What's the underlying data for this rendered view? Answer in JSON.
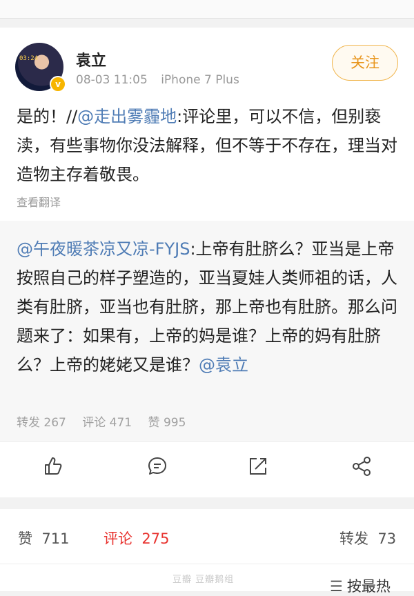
{
  "post": {
    "author": "袁立",
    "date": "08-03 11:05",
    "device": "iPhone 7 Plus",
    "follow_label": "关注",
    "avatar_text": "03:24",
    "text_prefix": "是的！//",
    "mention": "@走出雾霾地",
    "text_rest": ":评论里，可以不信，但别亵渎，有些事物你没法解释，但不等于不存在，理当对造物主存着敬畏。",
    "translate_label": "查看翻译"
  },
  "quoted": {
    "mention": "@午夜暖茶凉又凉-FYJS",
    "text": ":上帝有肚脐么？亚当是上帝按照自己的样子塑造的，亚当夏娃人类师祖的话，人类有肚脐，亚当也有肚脐，那上帝也有肚脐。那么问题来了：如果有，上帝的妈是谁？上帝的妈有肚脐么？上帝的姥姥又是谁？",
    "mention2": "@袁立",
    "stats": {
      "repost_label": "转发",
      "repost_count": "267",
      "comment_label": "评论",
      "comment_count": "471",
      "like_label": "赞",
      "like_count": "995"
    }
  },
  "actions": [
    "thumb-up-icon",
    "comment-icon",
    "share-out-icon",
    "share-nodes-icon"
  ],
  "bottom": {
    "like_label": "赞",
    "like_count": "711",
    "comment_label": "评论",
    "comment_count": "275",
    "repost_label": "转发",
    "repost_count": "73",
    "sort_label": "按最热",
    "watermark": "豆瓣 豆瓣鹅组"
  },
  "colors": {
    "link": "#4f7cb5",
    "follow": "#e8951c",
    "active": "#e8332f",
    "badge": "#f7b500"
  }
}
